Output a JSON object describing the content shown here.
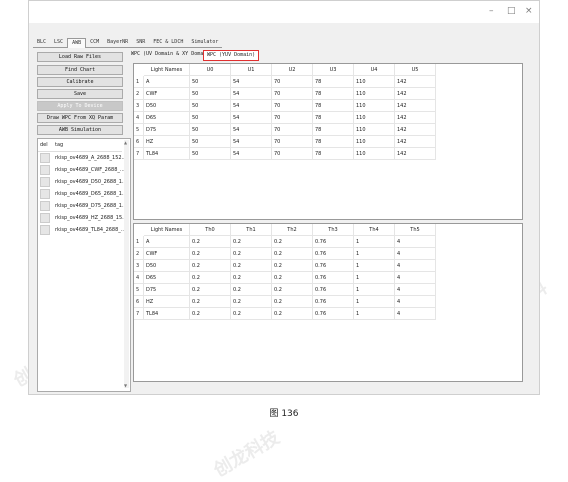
{
  "window": {
    "controls": [
      "–",
      "□",
      "×"
    ]
  },
  "tabs": [
    "BLC",
    "LSC",
    "AWB",
    "CCM",
    "BayerNR",
    "SNR",
    "FEC & LDCH",
    "Simulator"
  ],
  "active_tab": "AWB",
  "left": {
    "buttons": [
      "Load Raw Files",
      "Find Chart",
      "Calibrate",
      "Save",
      "Apply To Device",
      "Draw WPC From XQ Param",
      "AWB Simulation"
    ],
    "disabled_index": 4,
    "tag_headers": {
      "del": "del",
      "tag": "tag"
    },
    "tags": [
      "rkisp_ov4689_A_2688_152...",
      "rkisp_ov4689_CWF_2688_...",
      "rkisp_ov4689_D50_2688_1...",
      "rkisp_ov4689_D65_2688_1...",
      "rkisp_ov4689_D75_2688_1...",
      "rkisp_ov4689_HZ_2688_15...",
      "rkisp_ov4689_TL84_2688_..."
    ]
  },
  "sub_tabs": [
    "WPC (UV Domain & XY Domain)",
    "WPC (YUV Domain)"
  ],
  "top_table": {
    "headers": [
      "Light Names",
      "U0",
      "U1",
      "U2",
      "U3",
      "U4",
      "U5"
    ],
    "rows": [
      [
        "1",
        "A",
        "50",
        "54",
        "70",
        "78",
        "110",
        "142"
      ],
      [
        "2",
        "CWF",
        "50",
        "54",
        "70",
        "78",
        "110",
        "142"
      ],
      [
        "3",
        "D50",
        "50",
        "54",
        "70",
        "78",
        "110",
        "142"
      ],
      [
        "4",
        "D65",
        "50",
        "54",
        "70",
        "78",
        "110",
        "142"
      ],
      [
        "5",
        "D75",
        "50",
        "54",
        "70",
        "78",
        "110",
        "142"
      ],
      [
        "6",
        "HZ",
        "50",
        "54",
        "70",
        "78",
        "110",
        "142"
      ],
      [
        "7",
        "TL84",
        "50",
        "54",
        "70",
        "78",
        "110",
        "142"
      ]
    ]
  },
  "bottom_table": {
    "headers": [
      "Light Names",
      "Th0",
      "Th1",
      "Th2",
      "Th3",
      "Th4",
      "Th5"
    ],
    "rows": [
      [
        "1",
        "A",
        "0.2",
        "0.2",
        "0.2",
        "0.76",
        "1",
        "4"
      ],
      [
        "2",
        "CWF",
        "0.2",
        "0.2",
        "0.2",
        "0.76",
        "1",
        "4"
      ],
      [
        "3",
        "D50",
        "0.2",
        "0.2",
        "0.2",
        "0.76",
        "1",
        "4"
      ],
      [
        "4",
        "D65",
        "0.2",
        "0.2",
        "0.2",
        "0.76",
        "1",
        "4"
      ],
      [
        "5",
        "D75",
        "0.2",
        "0.2",
        "0.2",
        "0.76",
        "1",
        "4"
      ],
      [
        "6",
        "HZ",
        "0.2",
        "0.2",
        "0.2",
        "0.76",
        "1",
        "4"
      ],
      [
        "7",
        "TL84",
        "0.2",
        "0.2",
        "0.2",
        "0.76",
        "1",
        "4"
      ]
    ]
  },
  "caption": "图 136",
  "watermark": "创龙科技",
  "colors": {
    "selected_tab_border": "#e03030"
  }
}
